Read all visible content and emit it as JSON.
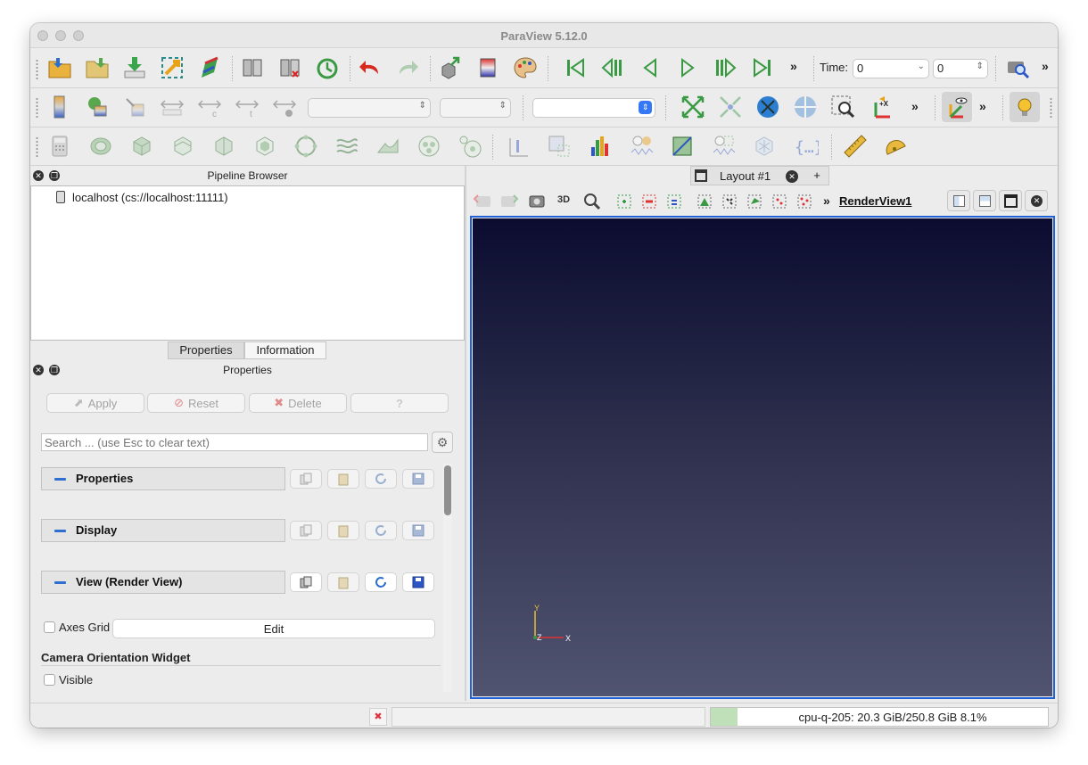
{
  "window": {
    "title": "ParaView 5.12.0"
  },
  "toolbar": {
    "time_label": "Time:",
    "time_value": "0",
    "time_index": "0",
    "overflow": "»"
  },
  "pipeline_browser": {
    "title": "Pipeline Browser",
    "server": "localhost (cs://localhost:11111)"
  },
  "panel_tabs": {
    "properties": "Properties",
    "information": "Information"
  },
  "properties_panel": {
    "title": "Properties",
    "apply": "Apply",
    "reset": "Reset",
    "delete": "Delete",
    "help": "?",
    "search_placeholder": "Search ... (use Esc to clear text)",
    "sections": {
      "properties": "Properties",
      "display": "Display",
      "view": "View (Render View)"
    },
    "axes_grid_label": "Axes Grid",
    "axes_grid_edit": "Edit",
    "camera_widget_heading": "Camera Orientation Widget",
    "visible_label": "Visible"
  },
  "layout": {
    "tab_label": "Layout #1",
    "add_tab": "+",
    "view_3d": "3D",
    "view_name": "RenderView1"
  },
  "axes": {
    "x": "X",
    "y": "Y",
    "z": "Z"
  },
  "status": {
    "memory": "cpu-q-205: 20.3 GiB/250.8 GiB 8.1%"
  }
}
